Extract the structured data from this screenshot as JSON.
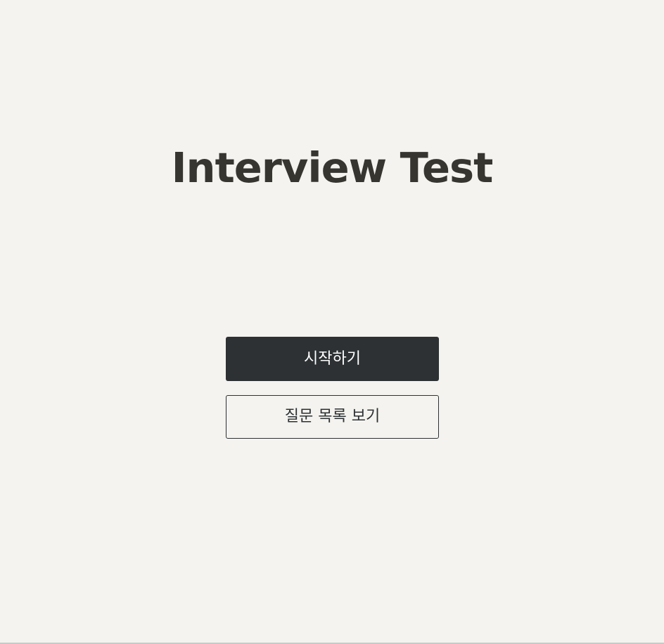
{
  "page": {
    "title": "Interview Test"
  },
  "actions": {
    "start_label": "시작하기",
    "question_list_label": "질문 목록 보기"
  },
  "colors": {
    "background": "#f4f3ef",
    "title_text": "#363530",
    "primary_button": "#2d3133",
    "primary_button_text": "#ffffff"
  }
}
